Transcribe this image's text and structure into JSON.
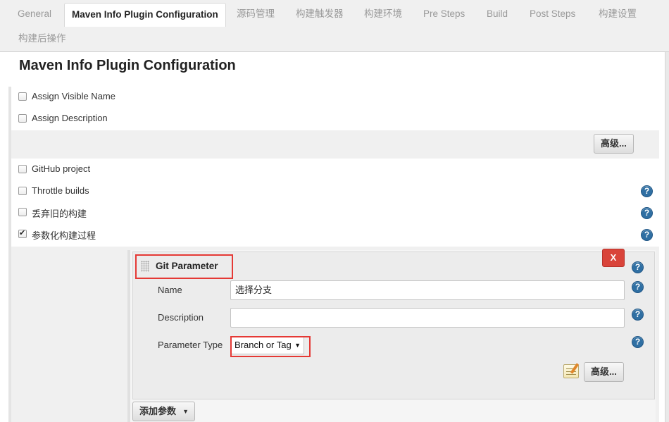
{
  "tabs": [
    {
      "label": "General",
      "active": false
    },
    {
      "label": "Maven Info Plugin Configuration",
      "active": true
    },
    {
      "label": "源码管理",
      "active": false
    },
    {
      "label": "构建触发器",
      "active": false
    },
    {
      "label": "构建环境",
      "active": false
    },
    {
      "label": "Pre Steps",
      "active": false
    },
    {
      "label": "Build",
      "active": false
    },
    {
      "label": "Post Steps",
      "active": false
    },
    {
      "label": "构建设置",
      "active": false
    },
    {
      "label": "构建后操作",
      "active": false
    }
  ],
  "section": {
    "title": "Maven Info Plugin Configuration"
  },
  "options": [
    {
      "label": "Assign Visible Name",
      "checked": false,
      "help": false
    },
    {
      "label": "Assign Description",
      "checked": false,
      "help": false
    },
    {
      "label": "GitHub project",
      "checked": false,
      "help": false
    },
    {
      "label": "Throttle builds",
      "checked": false,
      "help": true
    },
    {
      "label": "丢弃旧的构建",
      "checked": false,
      "help": true
    },
    {
      "label": "参数化构建过程",
      "checked": true,
      "help": true
    }
  ],
  "advanced_label": "高级...",
  "help_glyph": "?",
  "parameter": {
    "title": "Git Parameter",
    "delete_label": "X",
    "fields": {
      "name_label": "Name",
      "name_value": "选择分支",
      "description_label": "Description",
      "description_value": "",
      "type_label": "Parameter Type",
      "type_value": "Branch or Tag"
    },
    "advanced_label": "高级..."
  },
  "add_param_label": "添加参数",
  "colors": {
    "help_blue": "#2f6fa3",
    "delete_red": "#d9443a",
    "highlight_red": "#e53935"
  }
}
